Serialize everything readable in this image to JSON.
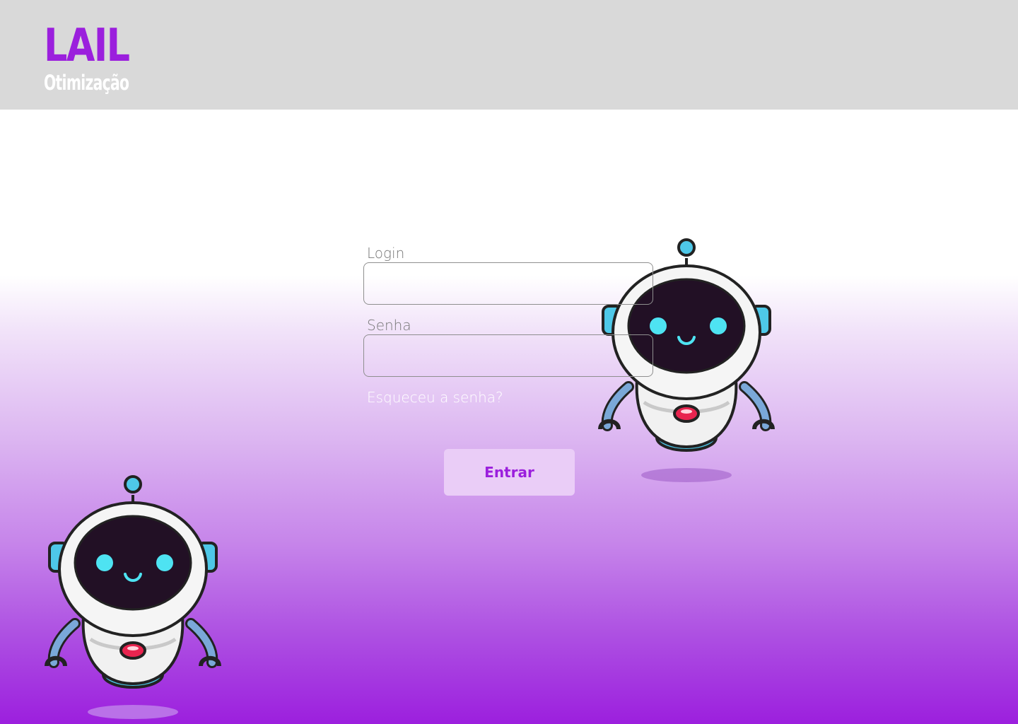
{
  "header": {
    "logo": {
      "main_text": "LAIL",
      "sub_text": "Otimização",
      "main_color": "#9b1fdd",
      "sub_color": "#ffffff"
    },
    "background": "#d9d9d9"
  },
  "login_form": {
    "login_label": "Login",
    "login_value": "",
    "password_label": "Senha",
    "password_value": "",
    "forgot_password_link": "Esqueceu a senha?",
    "submit_button": "Entrar"
  },
  "colors": {
    "accent": "#9b1fdd",
    "button_bg": "#eacdf7",
    "gradient_bottom": "#9c1fde"
  },
  "decorations": {
    "robots": [
      "robot-mascot",
      "robot-mascot"
    ]
  }
}
